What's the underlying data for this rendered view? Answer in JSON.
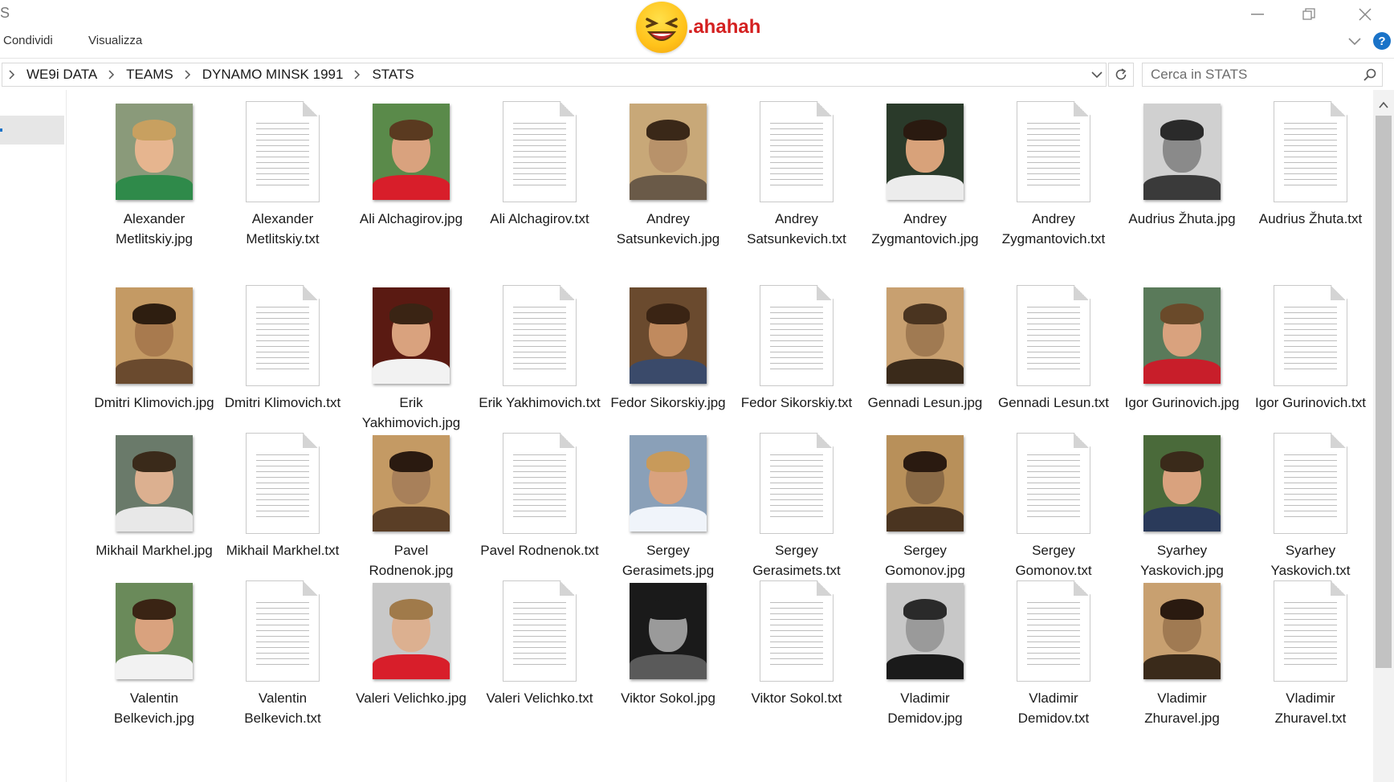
{
  "window": {
    "title_letter": "S",
    "overlay_text": "..ahahah"
  },
  "ribbon": {
    "tabs": [
      "Condividi",
      "Visualizza"
    ],
    "help_label": "?"
  },
  "address_bar": {
    "breadcrumbs": [
      "WE9i DATA",
      "TEAMS",
      "DYNAMO MINSK 1991",
      "STATS"
    ]
  },
  "search": {
    "placeholder": "Cerca in STATS"
  },
  "files": [
    {
      "name": "Alexander Metlitskiy.jpg",
      "type": "jpg",
      "bg": "#8a9a7a",
      "skin": "#e6b58f",
      "hair": "#c8a060",
      "shirt": "#2f8a4a"
    },
    {
      "name": "Alexander Metlitskiy.txt",
      "type": "txt"
    },
    {
      "name": "Ali Alchagirov.jpg",
      "type": "jpg",
      "bg": "#5a8a4a",
      "skin": "#d9a27e",
      "hair": "#5a3a20",
      "shirt": "#d81e2a"
    },
    {
      "name": "Ali Alchagirov.txt",
      "type": "txt"
    },
    {
      "name": "Andrey Satsunkevich.jpg",
      "type": "jpg",
      "bg": "#c8a878",
      "skin": "#b8926a",
      "hair": "#3a2818",
      "shirt": "#6a5a48"
    },
    {
      "name": "Andrey Satsunkevich.txt",
      "type": "txt"
    },
    {
      "name": "Andrey Zygmantovich.jpg",
      "type": "jpg",
      "bg": "#2a3a2a",
      "skin": "#d8a27a",
      "hair": "#2a1a10",
      "shirt": "#ececec"
    },
    {
      "name": "Andrey Zygmantovich.txt",
      "type": "txt"
    },
    {
      "name": "Audrius Žhuta.jpg",
      "type": "jpg",
      "bg": "#d0d0d0",
      "skin": "#8a8a8a",
      "hair": "#2a2a2a",
      "shirt": "#3a3a3a"
    },
    {
      "name": "Audrius Žhuta.txt",
      "type": "txt"
    },
    {
      "name": "Dmitri Klimovich.jpg",
      "type": "jpg",
      "bg": "#c49a64",
      "skin": "#a87a4e",
      "hair": "#2e1e10",
      "shirt": "#6a4a2e"
    },
    {
      "name": "Dmitri Klimovich.txt",
      "type": "txt"
    },
    {
      "name": "Erik Yakhimovich.jpg",
      "type": "jpg",
      "bg": "#5a1a12",
      "skin": "#d9a27e",
      "hair": "#3a2414",
      "shirt": "#f2f2f2"
    },
    {
      "name": "Erik Yakhimovich.txt",
      "type": "txt"
    },
    {
      "name": "Fedor Sikorskiy.jpg",
      "type": "jpg",
      "bg": "#6a4a2e",
      "skin": "#c08a5e",
      "hair": "#3a2414",
      "shirt": "#3a4a6a"
    },
    {
      "name": "Fedor Sikorskiy.txt",
      "type": "txt"
    },
    {
      "name": "Gennadi Lesun.jpg",
      "type": "jpg",
      "bg": "#c8a070",
      "skin": "#a07a52",
      "hair": "#4a3420",
      "shirt": "#3a2a1a"
    },
    {
      "name": "Gennadi Lesun.txt",
      "type": "txt"
    },
    {
      "name": "Igor Gurinovich.jpg",
      "type": "jpg",
      "bg": "#5a7a5a",
      "skin": "#d9a27e",
      "hair": "#6a4a2a",
      "shirt": "#c81e2a"
    },
    {
      "name": "Igor Gurinovich.txt",
      "type": "txt"
    },
    {
      "name": "Mikhail Markhel.jpg",
      "type": "jpg",
      "bg": "#6a7a6a",
      "skin": "#dcb090",
      "hair": "#3a2a1a",
      "shirt": "#e8e8e8"
    },
    {
      "name": "Mikhail Markhel.txt",
      "type": "txt"
    },
    {
      "name": "Pavel Rodnenok.jpg",
      "type": "jpg",
      "bg": "#c49a64",
      "skin": "#a8805a",
      "hair": "#2a1a10",
      "shirt": "#5a3e26"
    },
    {
      "name": "Pavel Rodnenok.txt",
      "type": "txt"
    },
    {
      "name": "Sergey Gerasimets.jpg",
      "type": "jpg",
      "bg": "#8aa0b8",
      "skin": "#d9a27e",
      "hair": "#c89a5a",
      "shirt": "#f0f4fa"
    },
    {
      "name": "Sergey Gerasimets.txt",
      "type": "txt"
    },
    {
      "name": "Sergey Gomonov.jpg",
      "type": "jpg",
      "bg": "#b8905a",
      "skin": "#8a6a46",
      "hair": "#2a1a10",
      "shirt": "#4a3420"
    },
    {
      "name": "Sergey Gomonov.txt",
      "type": "txt"
    },
    {
      "name": "Syarhey Yaskovich.jpg",
      "type": "jpg",
      "bg": "#4a6a3a",
      "skin": "#d9a27e",
      "hair": "#3a2a1a",
      "shirt": "#2a3a5a"
    },
    {
      "name": "Syarhey Yaskovich.txt",
      "type": "txt"
    },
    {
      "name": "Valentin Belkevich.jpg",
      "type": "jpg",
      "bg": "#6a8a5a",
      "skin": "#d9a27e",
      "hair": "#3a2414",
      "shirt": "#f2f2f2"
    },
    {
      "name": "Valentin Belkevich.txt",
      "type": "txt"
    },
    {
      "name": "Valeri Velichko.jpg",
      "type": "jpg",
      "bg": "#c8c8c8",
      "skin": "#dcb090",
      "hair": "#a07a4a",
      "shirt": "#d81e2a"
    },
    {
      "name": "Valeri Velichko.txt",
      "type": "txt"
    },
    {
      "name": "Viktor Sokol.jpg",
      "type": "jpg",
      "bg": "#1a1a1a",
      "skin": "#9a9a9a",
      "hair": "#1a1a1a",
      "shirt": "#5a5a5a"
    },
    {
      "name": "Viktor Sokol.txt",
      "type": "txt"
    },
    {
      "name": "Vladimir Demidov.jpg",
      "type": "jpg",
      "bg": "#c8c8c8",
      "skin": "#9a9a9a",
      "hair": "#2a2a2a",
      "shirt": "#1a1a1a"
    },
    {
      "name": "Vladimir Demidov.txt",
      "type": "txt"
    },
    {
      "name": "Vladimir Zhuravel.jpg",
      "type": "jpg",
      "bg": "#c8a070",
      "skin": "#a07a52",
      "hair": "#2a1a10",
      "shirt": "#3a2a1a"
    },
    {
      "name": "Vladimir Zhuravel.txt",
      "type": "txt"
    }
  ]
}
